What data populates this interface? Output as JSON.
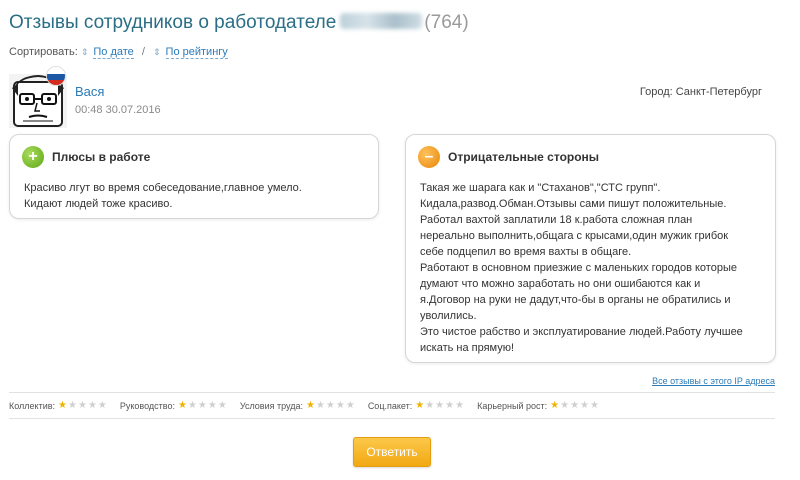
{
  "header": {
    "title": "Отзывы сотрудников о работодателе",
    "count": "(764)"
  },
  "sort": {
    "label": "Сортировать:",
    "by_date": "По дате",
    "separator": "/",
    "by_rating": "По рейтингу"
  },
  "review": {
    "author": "Вася",
    "date": "00:48 30.07.2016",
    "city": "Город: Санкт-Петербург",
    "pros": {
      "title": "Плюсы в работе",
      "icon": "plus-icon",
      "lines": [
        "Красиво лгут во время собеседование,главное умело.",
        "Кидают людей тоже красиво."
      ]
    },
    "cons": {
      "title": "Отрицательные стороны",
      "icon": "minus-icon",
      "lines": [
        "Такая же шарага как и \"Стаханов\",\"СТС групп\".",
        "Кидала,развод.Обман.Отзывы сами пишут положительные.",
        "Работал вахтой заплатили 18 к.работа сложная план",
        "нереально выполнить,общага с крысами,один мужик грибок",
        "себе подцепил во время вахты в общаге.",
        "Работают в основном приезжие с маленьких городов которые",
        "думают что можно заработать но они ошибаются как и",
        "я.Договор на руки не дадут,что-бы в органы не обратились и",
        "уволились.",
        "Это чистое рабство и эксплуатирование людей.Работу лучшее",
        "искать на прямую!"
      ]
    }
  },
  "ip_link": "Все отзывы с этого IP адреса",
  "ratings": [
    {
      "label": "Коллектив:",
      "value": 1,
      "max": 5
    },
    {
      "label": "Руководство:",
      "value": 1,
      "max": 5
    },
    {
      "label": "Условия труда:",
      "value": 1,
      "max": 5
    },
    {
      "label": "Соц.пакет:",
      "value": 1,
      "max": 5
    },
    {
      "label": "Карьерный рост:",
      "value": 1,
      "max": 5
    }
  ],
  "reply_button": "Ответить",
  "colors": {
    "title": "#2a6f86",
    "link": "#2a7bb8",
    "star_on": "#f0b400",
    "star_off": "#d0d0d0",
    "button": "#f2a812",
    "plus": "#5ea614",
    "minus": "#e8850a"
  }
}
